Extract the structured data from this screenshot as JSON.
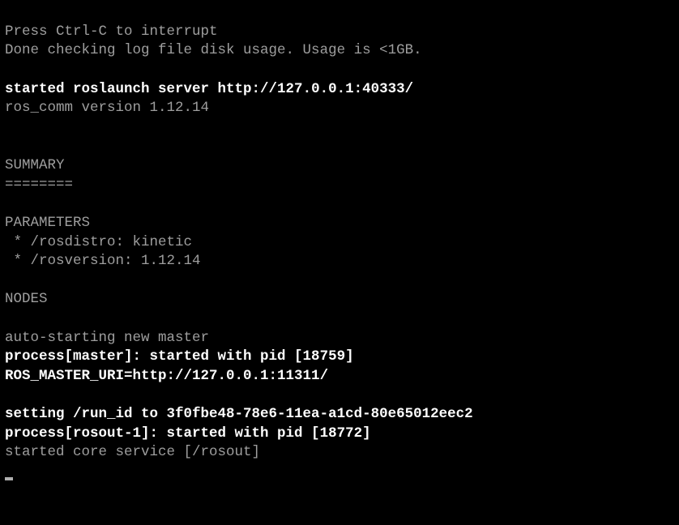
{
  "terminal": {
    "lines": {
      "interrupt_hint": "Press Ctrl-C to interrupt",
      "log_check": "Done checking log file disk usage. Usage is <1GB.",
      "blank1": "",
      "started_server_prefix": "started roslaunch server ",
      "started_server_url": "http://127.0.0.1:40333/",
      "ros_comm_version": "ros_comm version 1.12.14",
      "blank2": "",
      "blank3": "",
      "summary_header": "SUMMARY",
      "summary_divider": "========",
      "blank4": "",
      "parameters_header": "PARAMETERS",
      "param_rosdistro": " * /rosdistro: kinetic",
      "param_rosversion": " * /rosversion: 1.12.14",
      "blank5": "",
      "nodes_header": "NODES",
      "blank6": "",
      "auto_start": "auto-starting new master",
      "process_master": "process[master]: started with pid [18759]",
      "ros_master_uri": "ROS_MASTER_URI=http://127.0.0.1:11311/",
      "blank7": "",
      "run_id": "setting /run_id to 3f0fbe48-78e6-11ea-a1cd-80e65012eec2",
      "process_rosout": "process[rosout-1]: started with pid [18772]",
      "started_core": "started core service [/rosout]"
    }
  }
}
